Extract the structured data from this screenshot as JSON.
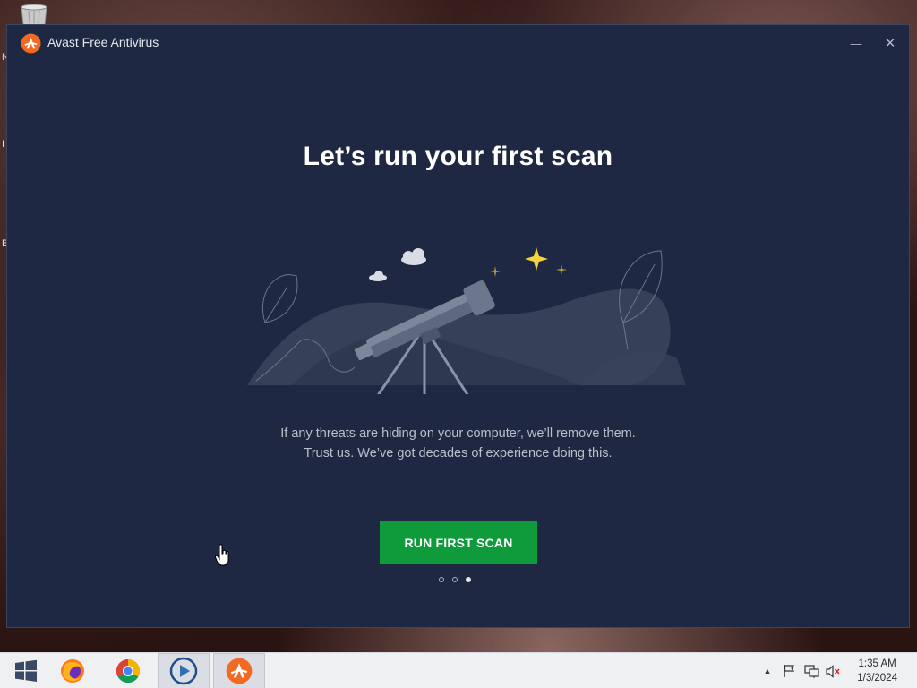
{
  "desktop": {
    "stray_chars": [
      "N",
      "I",
      "B"
    ]
  },
  "window": {
    "title": "Avast Free Antivirus",
    "minimize_glyph": "—",
    "close_glyph": "✕"
  },
  "content": {
    "heading": "Let’s run your first scan",
    "description_line1": "If any threats are hiding on your computer, we’ll remove them.",
    "description_line2": "Trust us. We’ve got decades of experience doing this.",
    "cta_label": "RUN FIRST SCAN",
    "pager": {
      "count": 3,
      "active_index": 2
    }
  },
  "taskbar": {
    "items": [
      "start-button",
      "firefox",
      "chrome",
      "media-player",
      "avast"
    ],
    "clock_time": "1:35 AM",
    "clock_date": "1/3/2024",
    "tray_glyph": "▲"
  },
  "colors": {
    "window_bg": "#1f2842",
    "accent_orange": "#f26a21",
    "cta_green": "#0f9a3b"
  }
}
